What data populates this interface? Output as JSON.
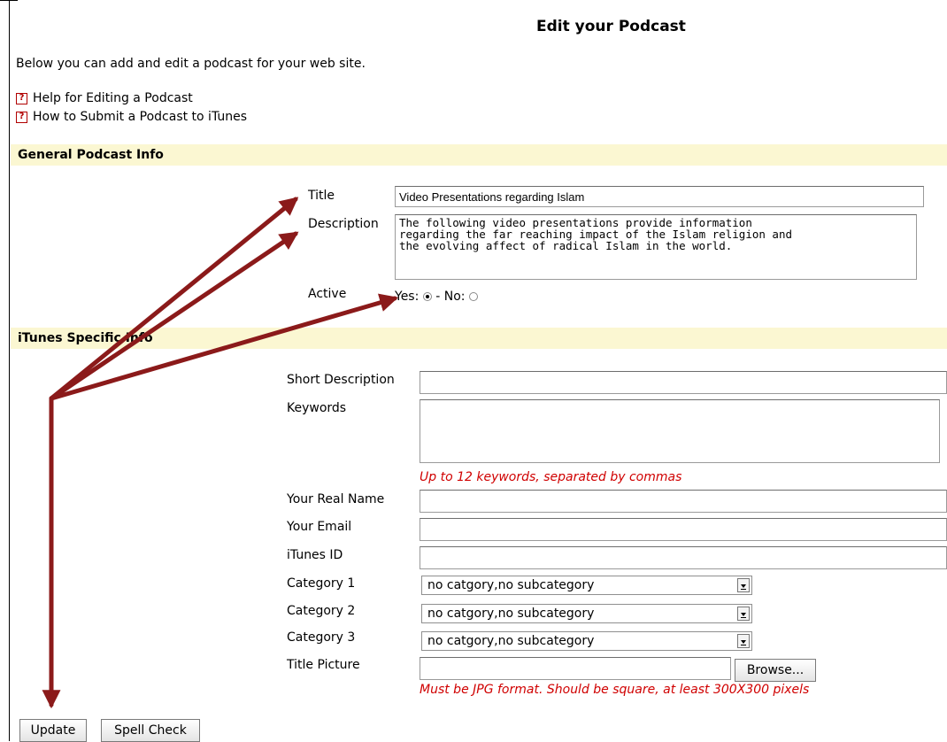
{
  "page": {
    "title": "Edit your Podcast",
    "intro": "Below you can add and edit a podcast for your web site.",
    "help_links": [
      {
        "label": "Help for Editing a Podcast",
        "icon": "help-question-icon"
      },
      {
        "label": "How to Submit a Podcast to iTunes",
        "icon": "help-question-icon"
      }
    ]
  },
  "general": {
    "section_title": "General Podcast Info",
    "title_label": "Title",
    "title_value": "Video Presentations regarding Islam",
    "description_label": "Description",
    "description_value": "The following video presentations provide information\nregarding the far reaching impact of the Islam religion and\nthe evolving affect of radical Islam in the world.",
    "active_label": "Active",
    "active_yes": "Yes:",
    "active_no": "- No:",
    "active_selected": "yes"
  },
  "itunes": {
    "section_title": "iTunes Specific Info",
    "short_description_label": "Short Description",
    "short_description_value": "",
    "keywords_label": "Keywords",
    "keywords_value": "",
    "keywords_hint": "Up to 12 keywords, separated by commas",
    "real_name_label": "Your Real Name",
    "real_name_value": "",
    "email_label": "Your Email",
    "email_value": "",
    "itunes_id_label": "iTunes ID",
    "itunes_id_value": "",
    "category1_label": "Category 1",
    "category1_value": "no catgory,no subcategory",
    "category2_label": "Category 2",
    "category2_value": "no catgory,no subcategory",
    "category3_label": "Category 3",
    "category3_value": "no catgory,no subcategory",
    "title_picture_label": "Title Picture",
    "title_picture_value": "",
    "browse_label": "Browse...",
    "picture_hint": "Must be JPG format. Should be square, at least 300X300 pixels"
  },
  "actions": {
    "update_label": "Update",
    "spell_check_label": "Spell Check"
  },
  "colors": {
    "section_bar": "#fbf7d2",
    "hint_text": "#d00000",
    "annotation_arrow": "#8b1a1a"
  }
}
